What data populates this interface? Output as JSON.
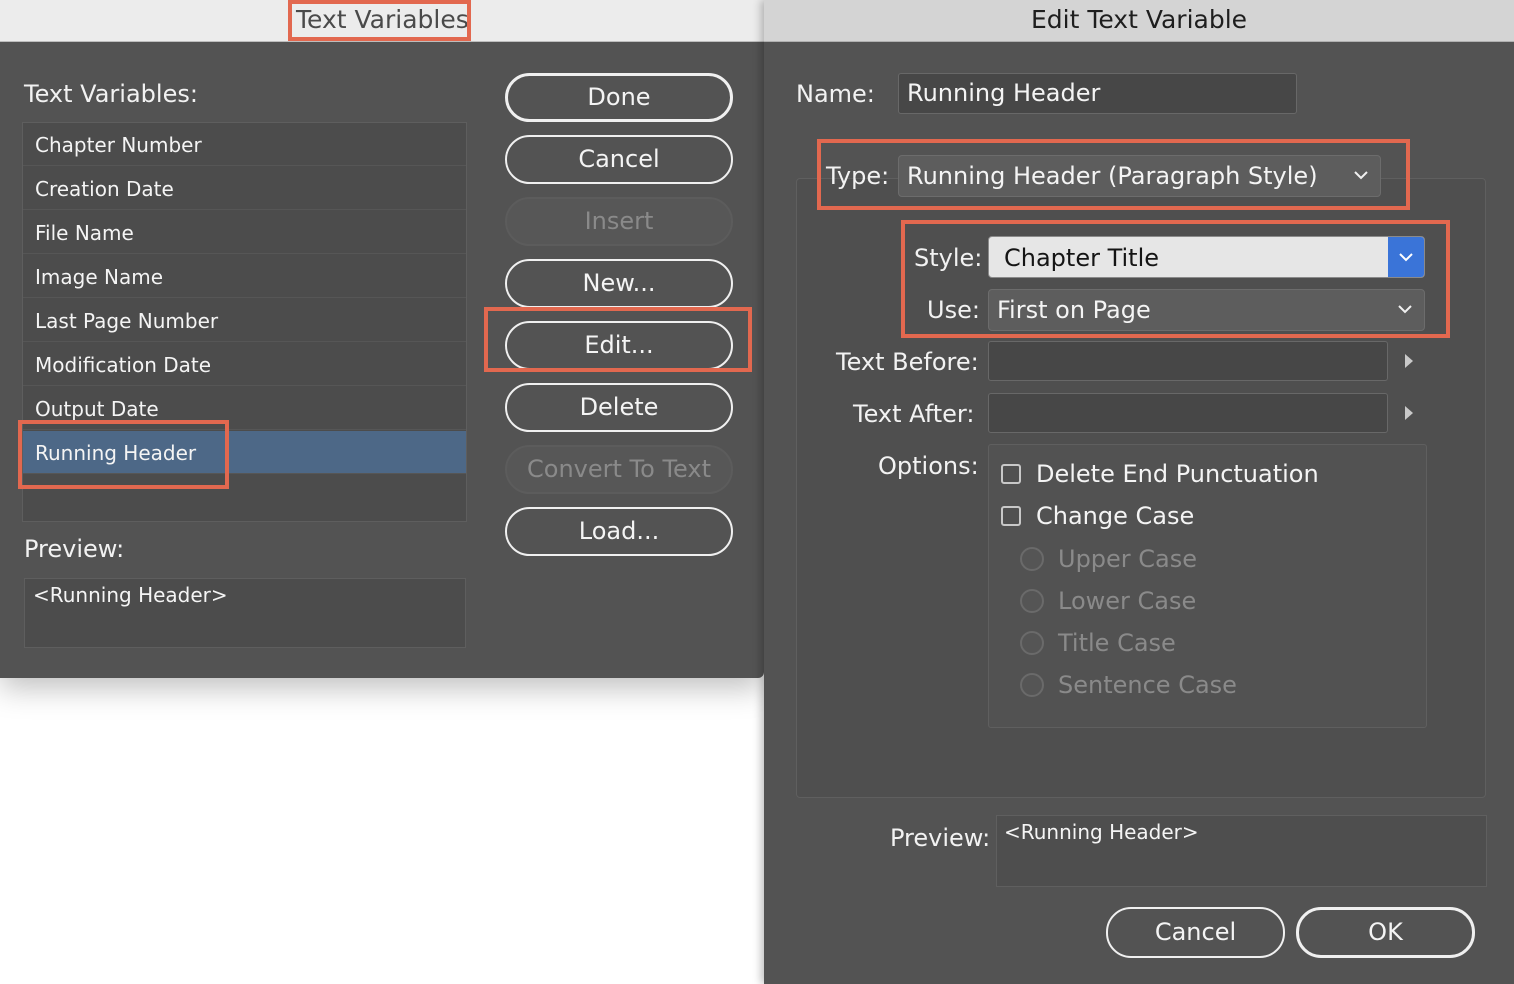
{
  "text_variables_dialog": {
    "title": "Text Variables",
    "list_label": "Text Variables:",
    "variables": [
      "Chapter Number",
      "Creation Date",
      "File Name",
      "Image Name",
      "Last Page Number",
      "Modification Date",
      "Output Date",
      "Running Header"
    ],
    "selected_variable": "Running Header",
    "preview_label": "Preview:",
    "preview_value": "<Running Header>",
    "buttons": {
      "done": "Done",
      "cancel": "Cancel",
      "insert": "Insert",
      "new": "New...",
      "edit": "Edit...",
      "delete": "Delete",
      "convert": "Convert To Text",
      "load": "Load..."
    }
  },
  "edit_text_variable_dialog": {
    "title": "Edit Text Variable",
    "name_label": "Name:",
    "name_value": "Running Header",
    "type_label": "Type:",
    "type_value": "Running Header (Paragraph Style)",
    "style_label": "Style:",
    "style_value": "Chapter Title",
    "use_label": "Use:",
    "use_value": "First on Page",
    "text_before_label": "Text Before:",
    "text_before_value": "",
    "text_after_label": "Text After:",
    "text_after_value": "",
    "options_label": "Options:",
    "options": {
      "delete_end_punctuation": "Delete End Punctuation",
      "change_case": "Change Case",
      "upper_case": "Upper Case",
      "lower_case": "Lower Case",
      "title_case": "Title Case",
      "sentence_case": "Sentence Case"
    },
    "preview_label": "Preview:",
    "preview_value": "<Running Header>",
    "buttons": {
      "cancel": "Cancel",
      "ok": "OK"
    }
  },
  "colors": {
    "highlight": "#e2684f",
    "selection": "#4d6887",
    "dialog_bg": "#535353",
    "popup_accent": "#3a74d8"
  },
  "icons": [
    "chevron-down-icon",
    "disclosure-arrow-icon"
  ]
}
